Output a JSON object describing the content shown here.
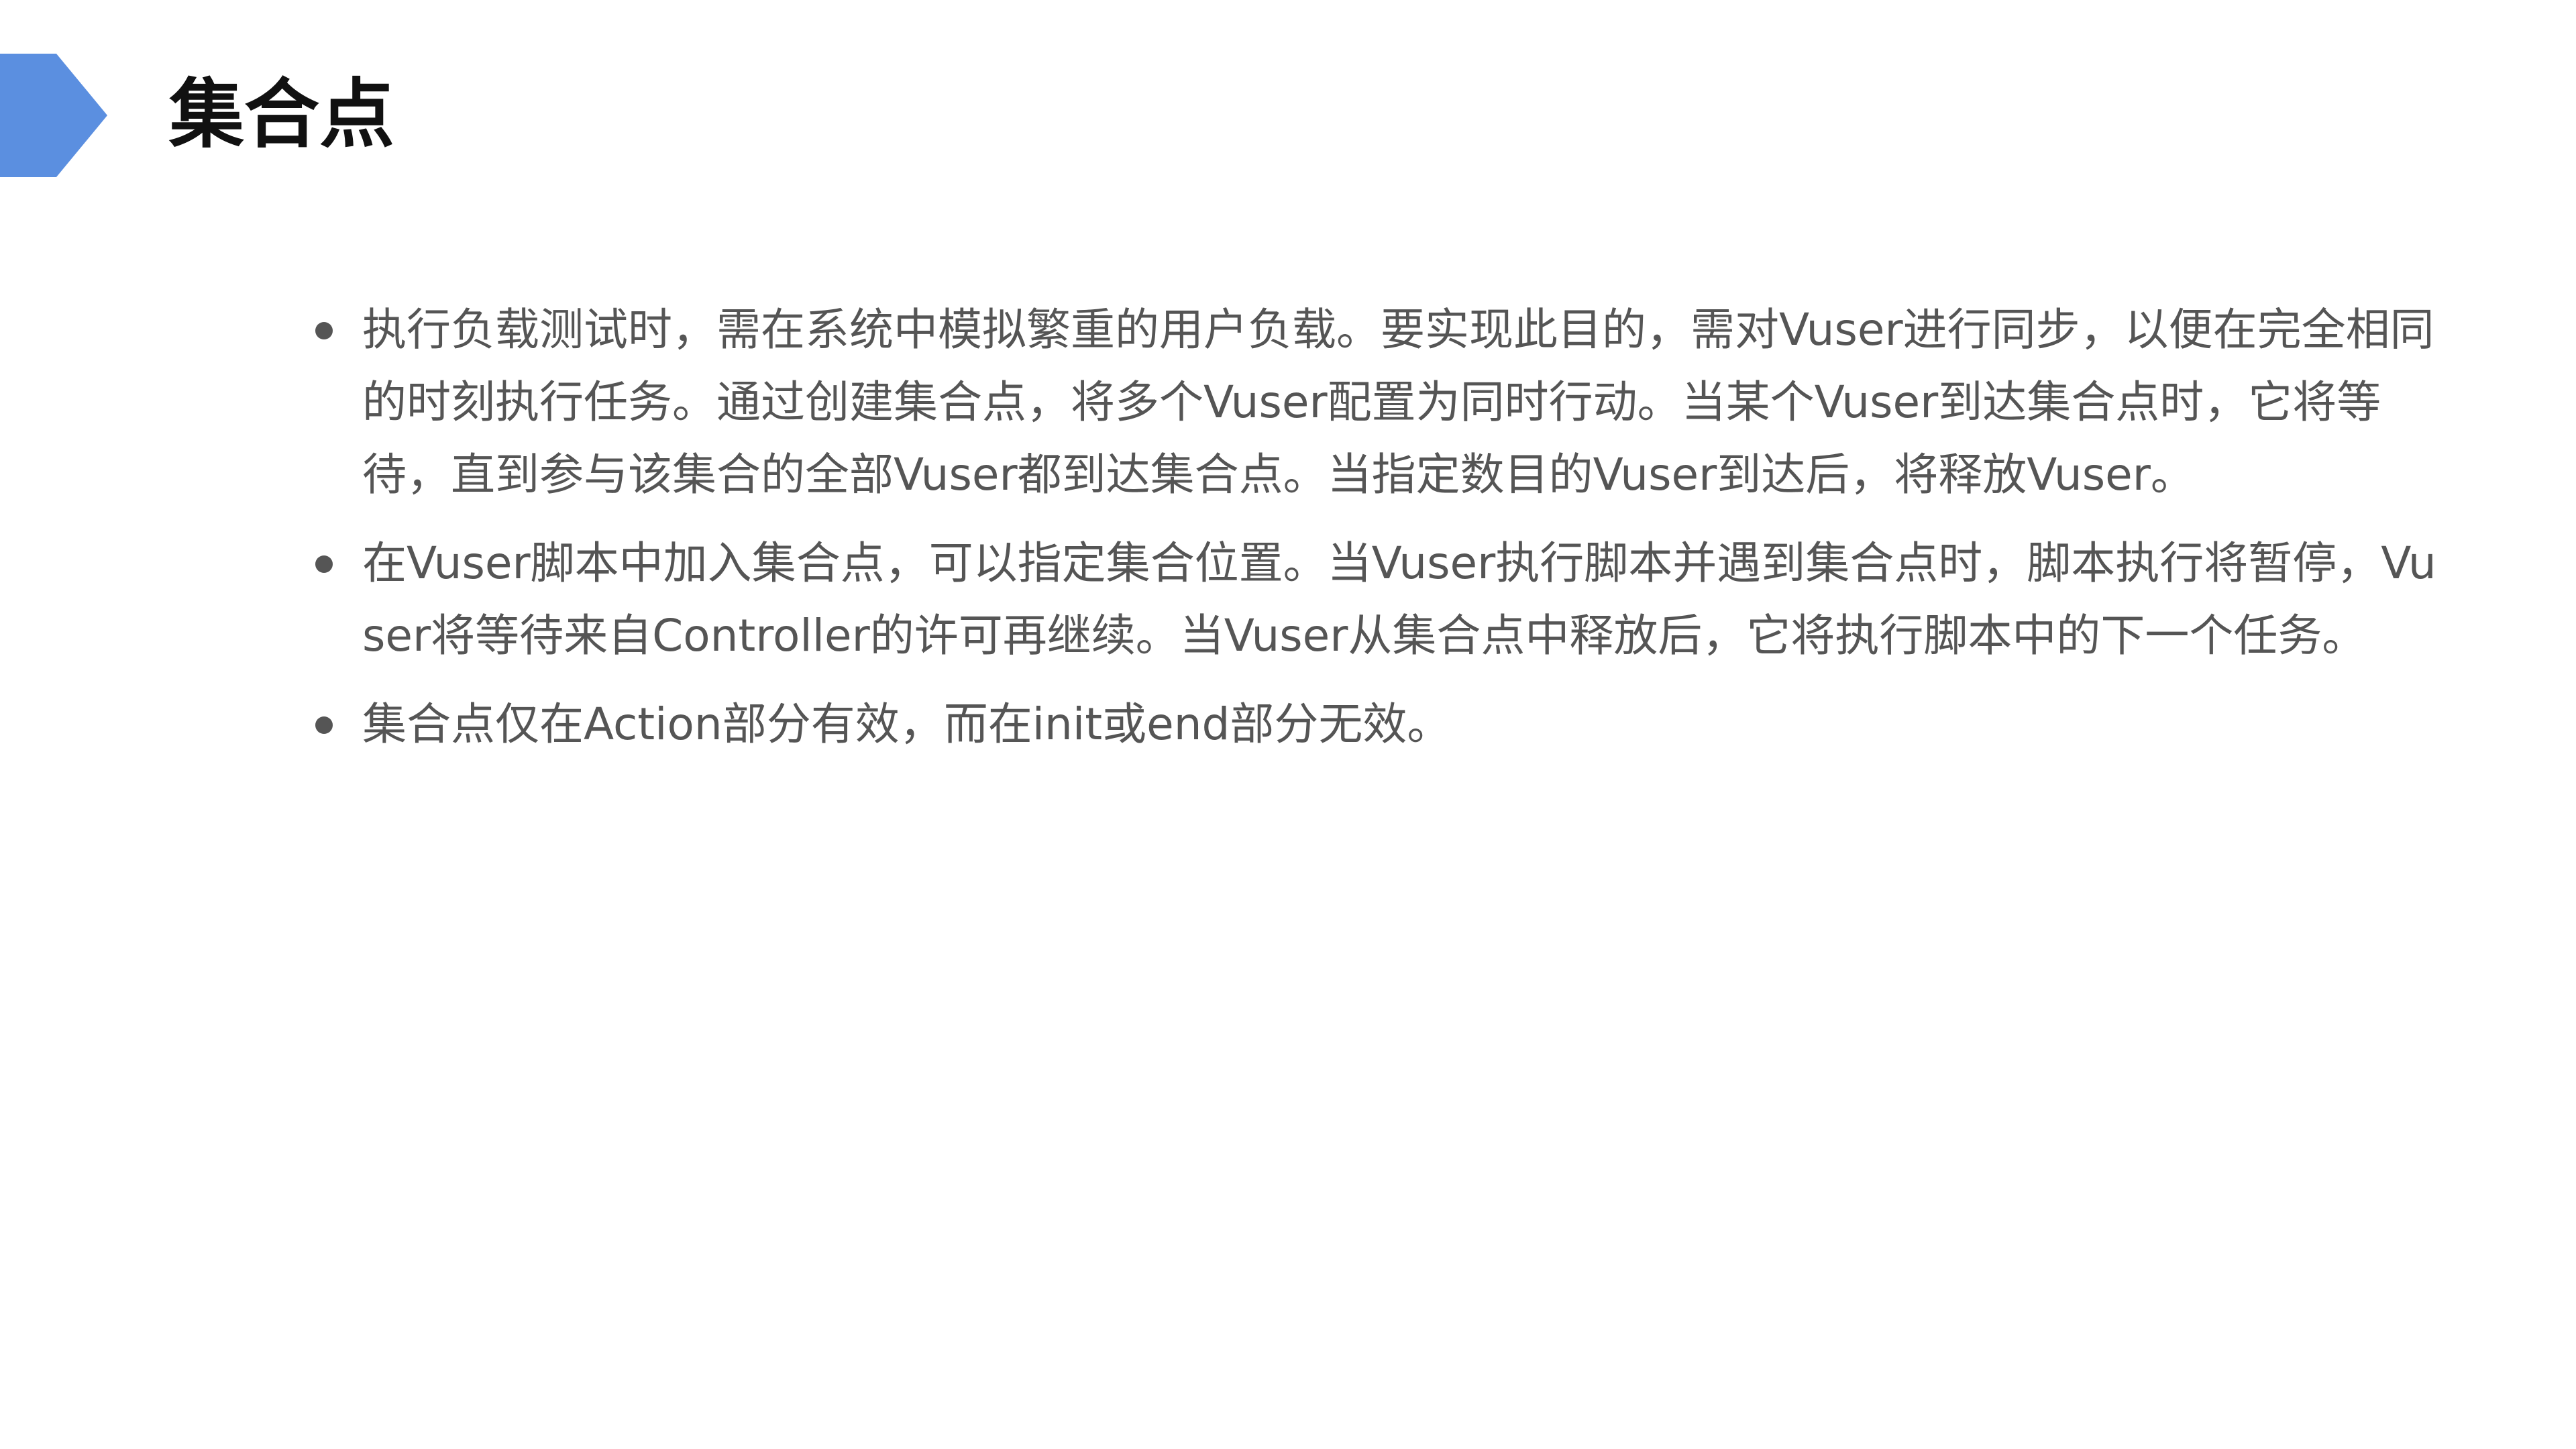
{
  "slide": {
    "title": "集合点",
    "accent_color": "#5b8fe0",
    "bullets": [
      "执行负载测试时，需在系统中模拟繁重的用户负载。要实现此目的，需对Vuser进行同步，以便在完全相同的时刻执行任务。通过创建集合点，将多个Vuser配置为同时行动。当某个Vuser到达集合点时，它将等待，直到参与该集合的全部Vuser都到达集合点。当指定数目的Vuser到达后，将释放Vuser。",
      "在Vuser脚本中加入集合点，可以指定集合位置。当Vuser执行脚本并遇到集合点时，脚本执行将暂停，Vuser将等待来自Controller的许可再继续。当Vuser从集合点中释放后，它将执行脚本中的下一个任务。",
      "集合点仅在Action部分有效，而在init或end部分无效。"
    ]
  }
}
